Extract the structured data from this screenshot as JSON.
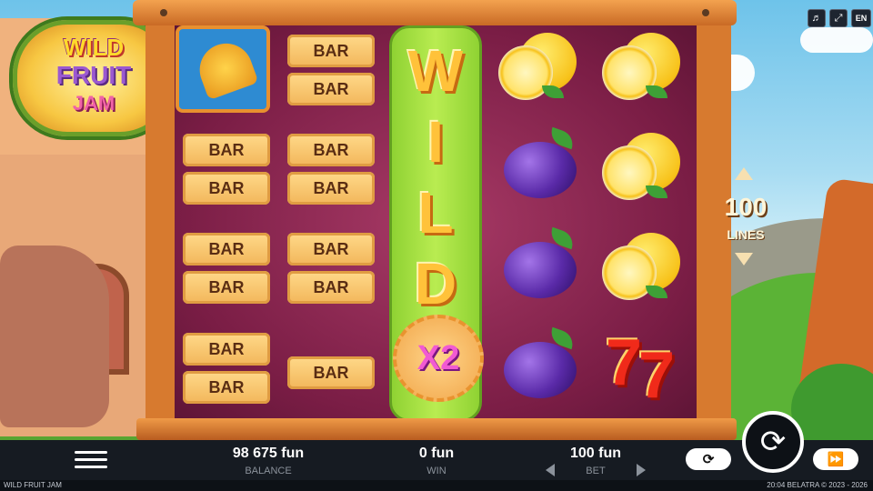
{
  "game": {
    "logo_line1": "WILD",
    "logo_line2": "FRUIT",
    "logo_line3": "JAM",
    "lines_value": "100",
    "lines_label": "LINES",
    "wild_letters": [
      "W",
      "I",
      "L",
      "D"
    ],
    "multiplier": "X2",
    "bar_label": "BAR",
    "seven": "7"
  },
  "top_controls": {
    "sound_icon": "speaker-icon",
    "fullscreen_icon": "fullscreen-icon",
    "language": "EN"
  },
  "bottom": {
    "balance_value": "98 675 fun",
    "balance_label": "BALANCE",
    "win_value": "0 fun",
    "win_label": "WIN",
    "bet_value": "100 fun",
    "bet_label": "BET"
  },
  "footer": {
    "title": "WILD FRUIT JAM",
    "time": "20:04",
    "copyright": "BELATRA © 2023 - 2026"
  }
}
